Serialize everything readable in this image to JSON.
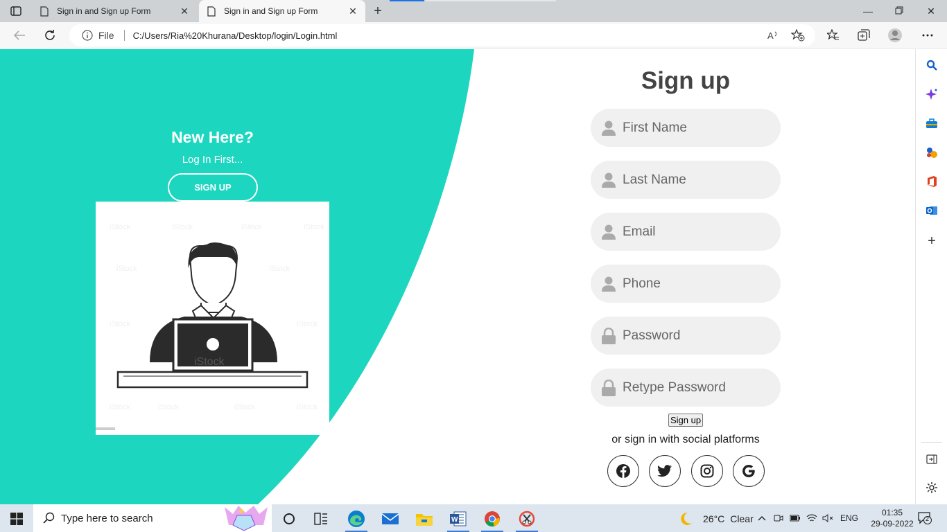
{
  "browser": {
    "tabs": [
      {
        "title": "Sign in and Sign up Form"
      },
      {
        "title": "Sign in and Sign up Form"
      }
    ],
    "address": {
      "scheme_label": "File",
      "url": "C:/Users/Ria%20Khurana/Desktop/login/Login.html"
    }
  },
  "left_panel": {
    "heading": "New Here?",
    "subtext": "Log In First...",
    "button_label": "SIGN UP",
    "watermark": "iStock",
    "accent_color": "#1cd6bf"
  },
  "form": {
    "title": "Sign up",
    "fields": [
      {
        "placeholder": "First Name",
        "icon": "user-icon"
      },
      {
        "placeholder": "Last Name",
        "icon": "user-icon"
      },
      {
        "placeholder": "Email",
        "icon": "user-icon"
      },
      {
        "placeholder": "Phone",
        "icon": "user-icon"
      },
      {
        "placeholder": "Password",
        "icon": "lock-icon"
      },
      {
        "placeholder": "Retype Password",
        "icon": "lock-icon"
      }
    ],
    "submit_label": "Sign up",
    "social_text": "or sign in with social platforms",
    "social": [
      "facebook-icon",
      "twitter-icon",
      "instagram-icon",
      "google-icon"
    ]
  },
  "taskbar": {
    "search_placeholder": "Type here to search",
    "weather_temp": "26°C",
    "weather_desc": "Clear",
    "language": "ENG",
    "time": "01:35",
    "date": "29-09-2022",
    "notification_count": "2"
  }
}
